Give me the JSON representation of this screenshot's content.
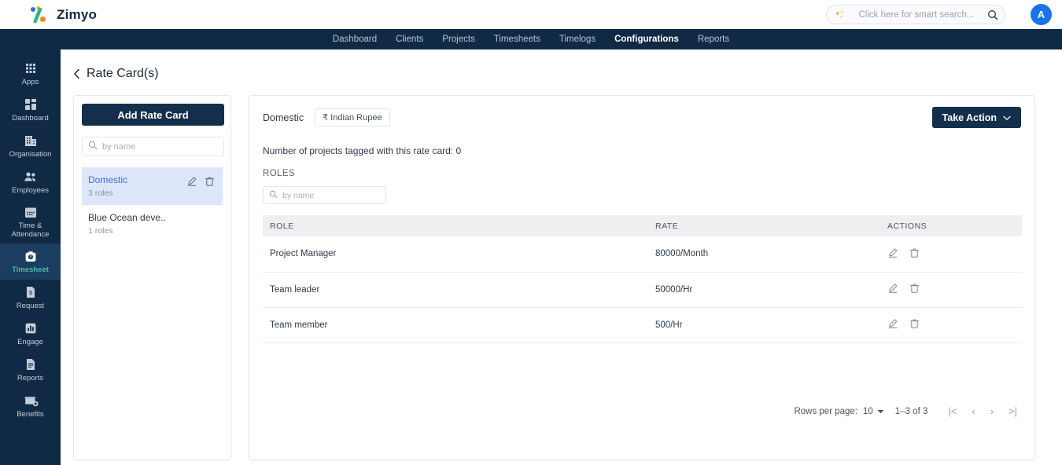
{
  "topbar": {
    "brand": "Zimyo",
    "logo_icon": "zimyo-percent-logo",
    "search": {
      "placeholder": "Click here for smart search...",
      "value": "",
      "sparkle_icon": "sparkle-icon",
      "search_icon": "search-icon"
    },
    "avatar_initial": "A",
    "avatar_color": "#1a73e8"
  },
  "nav": {
    "items": [
      {
        "label": "Dashboard",
        "active": false
      },
      {
        "label": "Clients",
        "active": false
      },
      {
        "label": "Projects",
        "active": false
      },
      {
        "label": "Timesheets",
        "active": false
      },
      {
        "label": "Timelogs",
        "active": false
      },
      {
        "label": "Configurations",
        "active": true
      },
      {
        "label": "Reports",
        "active": false
      }
    ]
  },
  "sidebar": {
    "items": [
      {
        "label": "Apps",
        "icon": "grid-dots-icon",
        "active": false
      },
      {
        "label": "Dashboard",
        "icon": "dashboard-squares-icon",
        "active": false
      },
      {
        "label": "Organisation",
        "icon": "building-icon",
        "active": false
      },
      {
        "label": "Employees",
        "icon": "people-icon",
        "active": false
      },
      {
        "label": "Time & Attendance",
        "icon": "calendar-icon",
        "active": false
      },
      {
        "label": "Timesheet",
        "icon": "stopwatch-bag-icon",
        "active": true
      },
      {
        "label": "Request",
        "icon": "money-document-icon",
        "active": false
      },
      {
        "label": "Engage",
        "icon": "bar-chart-icon",
        "active": false
      },
      {
        "label": "Reports",
        "icon": "report-document-icon",
        "active": false
      },
      {
        "label": "Benefits",
        "icon": "benefits-plus-icon",
        "active": false
      }
    ],
    "active_label_color": "#4cbba1",
    "background": "#102a45"
  },
  "page": {
    "title": "Rate Card(s)",
    "back_icon": "chevron-left-icon"
  },
  "left_panel": {
    "add_button": "Add Rate Card",
    "search_placeholder": "by name",
    "search_value": "",
    "search_icon": "search-icon",
    "items": [
      {
        "title": "Domestic",
        "subtitle": "3 roles",
        "selected": true,
        "edit_icon": "edit-pencil-icon",
        "delete_icon": "trash-icon"
      },
      {
        "title": "Blue Ocean deve..",
        "subtitle": "1 roles",
        "selected": false,
        "edit_icon": "edit-pencil-icon",
        "delete_icon": "trash-icon"
      }
    ]
  },
  "detail": {
    "title": "Domestic",
    "currency_chip": "₹ Indian Rupee",
    "take_action_button": "Take Action",
    "take_action_chevron": "chevron-down-icon",
    "tagged_projects_line": "Number of projects tagged with this rate card: 0",
    "roles_label": "ROLES",
    "roles_search_placeholder": "by name",
    "roles_search_value": "",
    "table": {
      "columns": [
        "ROLE",
        "RATE",
        "ACTIONS"
      ],
      "rows": [
        {
          "role": "Project Manager",
          "rate": "80000/Month"
        },
        {
          "role": "Team leader",
          "rate": "50000/Hr"
        },
        {
          "role": "Team member",
          "rate": "500/Hr"
        }
      ]
    },
    "pagination": {
      "rows_per_page_label": "Rows per page:",
      "rows_per_page_value": "10",
      "range_label": "1–3 of 3",
      "first_icon": "|<",
      "prev_icon": "‹",
      "next_icon": "›",
      "last_icon": ">|"
    }
  },
  "colors": {
    "navy": "#102a45",
    "button_navy": "#142f4c",
    "selected_row": "#dde6fa",
    "selected_text": "#3f6fd8",
    "accent_teal": "#4cbba1"
  }
}
